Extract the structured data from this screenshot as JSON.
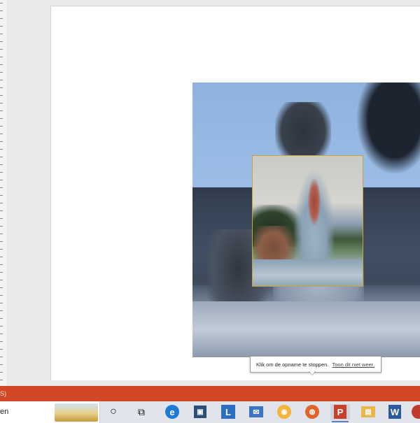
{
  "status_bar": {
    "text": "S)"
  },
  "tooltip": {
    "text": "Klik om de opname te stoppen.",
    "link": "Toon dit niet weer."
  },
  "taskbar": {
    "search_text": "en",
    "icons": [
      {
        "name": "task-view-circle-icon",
        "glyph": "○"
      },
      {
        "name": "task-view-icon",
        "glyph": "⧉"
      },
      {
        "name": "edge-icon",
        "glyph": "e"
      },
      {
        "name": "store-icon",
        "glyph": "▣"
      },
      {
        "name": "lync-icon",
        "glyph": "L"
      },
      {
        "name": "mail-icon",
        "glyph": "✉"
      },
      {
        "name": "chrome-canary-icon",
        "glyph": "◉"
      },
      {
        "name": "firefox-icon",
        "glyph": "◍"
      },
      {
        "name": "powerpoint-icon",
        "glyph": "P"
      },
      {
        "name": "file-explorer-icon",
        "glyph": "▤"
      },
      {
        "name": "word-icon",
        "glyph": "W"
      },
      {
        "name": "app-icon",
        "glyph": "◔"
      }
    ],
    "colors": {
      "edge": "#1f7ad4",
      "store": "#2a4d7a",
      "lync": "#2b6fc2",
      "mail": "#3a74c9",
      "chrome_canary": "#f1b63b",
      "firefox": "#e2632a",
      "powerpoint": "#c9402a",
      "explorer": "#e8b84a",
      "word": "#2c5aa0",
      "app": "#c23a2e"
    }
  },
  "colors": {
    "status_bar": "#d24726",
    "selection_border": "#c9a436"
  }
}
